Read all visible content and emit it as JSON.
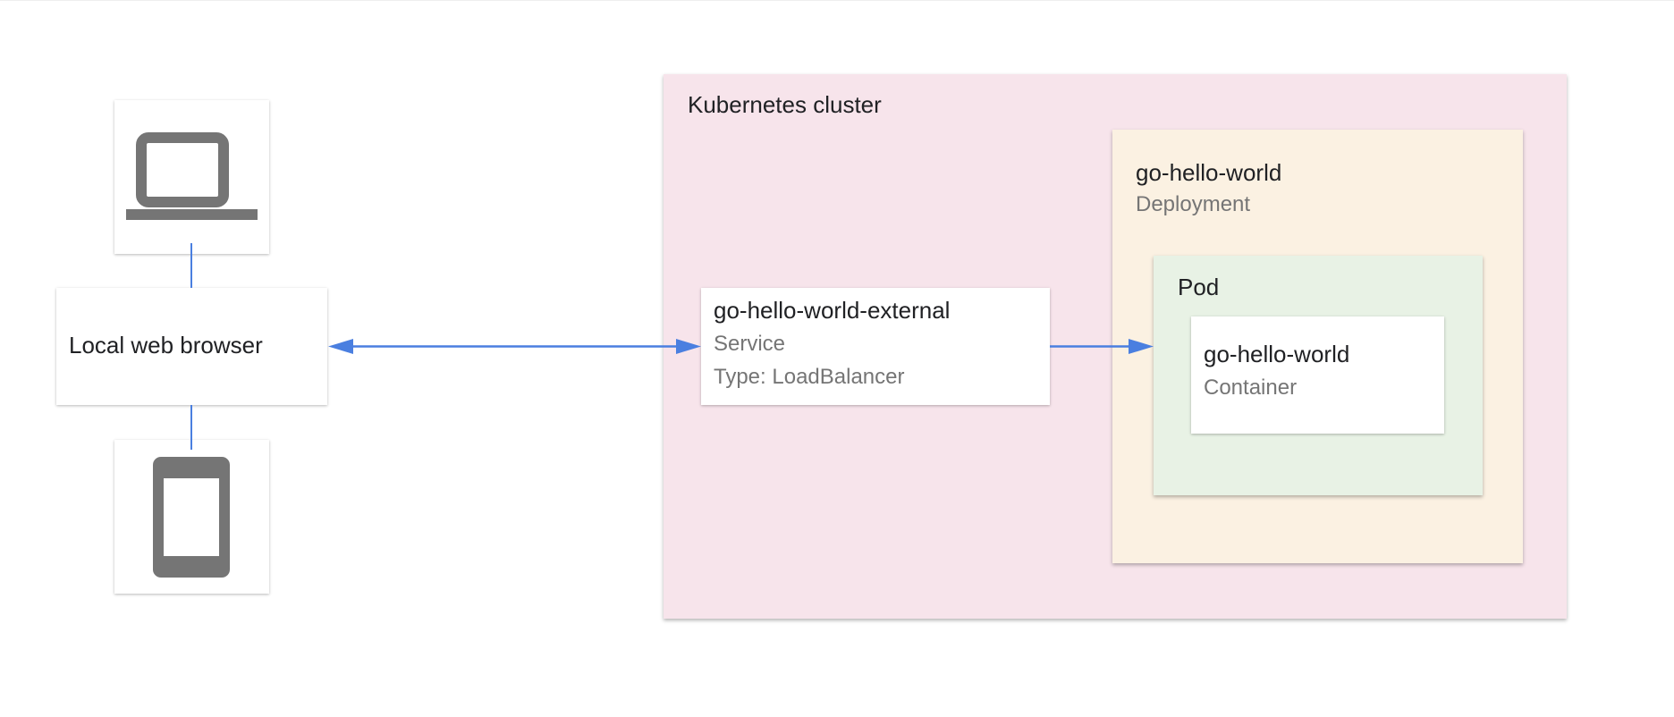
{
  "diagram": {
    "browser": {
      "label": "Local web browser"
    },
    "devices": {
      "laptop_icon": "laptop-icon",
      "phone_icon": "phone-icon"
    },
    "cluster": {
      "title": "Kubernetes cluster"
    },
    "service": {
      "name": "go-hello-world-external",
      "kind": "Service",
      "type": "Type: LoadBalancer"
    },
    "deployment": {
      "name": "go-hello-world",
      "kind": "Deployment"
    },
    "pod": {
      "title": "Pod"
    },
    "container": {
      "name": "go-hello-world",
      "kind": "Container"
    },
    "colors": {
      "connector": "#4a7fe0",
      "icon": "#757575",
      "cluster_bg": "#f7e4eb",
      "deployment_bg": "#fbf1e2",
      "pod_bg": "#e8f2e5"
    }
  }
}
